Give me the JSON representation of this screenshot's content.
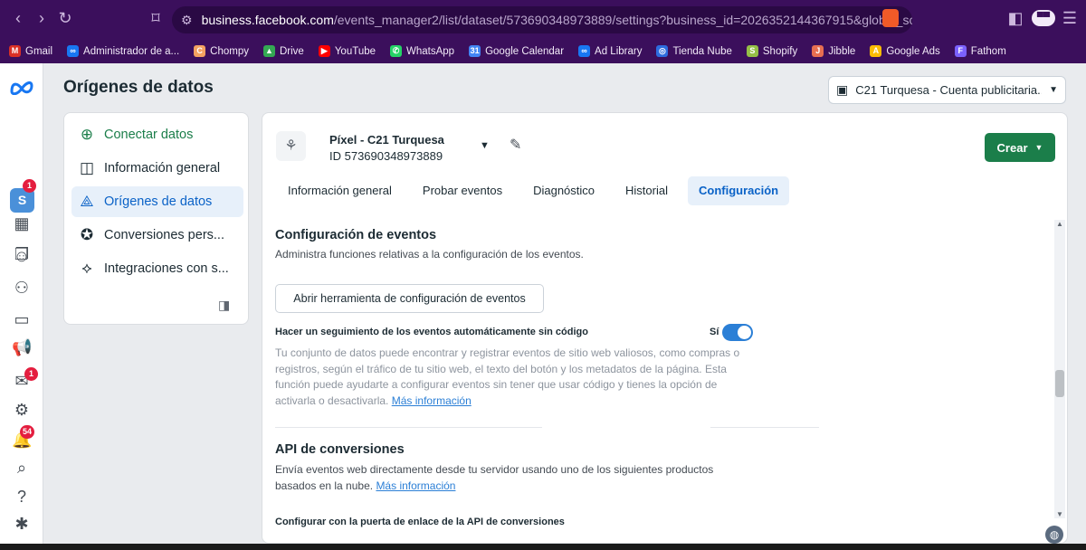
{
  "browser": {
    "url_host": "business.facebook.com",
    "url_rest": "/events_manager2/list/dataset/573690348973889/settings?business_id=2026352144367915&global_scope_id...",
    "bookmarks": [
      {
        "label": "Gmail",
        "icon": "gmail-icon",
        "color": "#d93025",
        "glyph": "M"
      },
      {
        "label": "Administrador de a...",
        "icon": "meta-icon",
        "color": "#1877f2",
        "glyph": "∞"
      },
      {
        "label": "Chompy",
        "icon": "chompy-icon",
        "color": "#f4a261",
        "glyph": "C"
      },
      {
        "label": "Drive",
        "icon": "drive-icon",
        "color": "#34a853",
        "glyph": "▲"
      },
      {
        "label": "YouTube",
        "icon": "youtube-icon",
        "color": "#ff0000",
        "glyph": "▶"
      },
      {
        "label": "WhatsApp",
        "icon": "whatsapp-icon",
        "color": "#25d366",
        "glyph": "✆"
      },
      {
        "label": "Google Calendar",
        "icon": "calendar-icon",
        "color": "#4285f4",
        "glyph": "31"
      },
      {
        "label": "Ad Library",
        "icon": "meta-icon",
        "color": "#1877f2",
        "glyph": "∞"
      },
      {
        "label": "Tienda Nube",
        "icon": "tiendanube-icon",
        "color": "#2d6cdf",
        "glyph": "◎"
      },
      {
        "label": "Shopify",
        "icon": "shopify-icon",
        "color": "#95bf47",
        "glyph": "S"
      },
      {
        "label": "Jibble",
        "icon": "jibble-icon",
        "color": "#e76f51",
        "glyph": "J"
      },
      {
        "label": "Google Ads",
        "icon": "googleads-icon",
        "color": "#fbbc04",
        "glyph": "A"
      },
      {
        "label": "Fathom",
        "icon": "fathom-icon",
        "color": "#7b61ff",
        "glyph": "F"
      }
    ]
  },
  "rail": {
    "avatar": "S",
    "badges": {
      "notifications": "1",
      "inbox": "1",
      "alerts": "54"
    }
  },
  "header": {
    "title": "Orígenes de datos",
    "account": "C21 Turquesa - Cuenta publicitaria..."
  },
  "sidebar": {
    "items": [
      {
        "label": "Conectar datos"
      },
      {
        "label": "Información general"
      },
      {
        "label": "Orígenes de datos"
      },
      {
        "label": "Conversiones pers..."
      },
      {
        "label": "Integraciones con s..."
      }
    ]
  },
  "pixel": {
    "name": "Píxel - C21 Turquesa",
    "id": "ID 573690348973889",
    "create_label": "Crear"
  },
  "tabs": [
    "Información general",
    "Probar eventos",
    "Diagnóstico",
    "Historial",
    "Configuración"
  ],
  "config": {
    "title": "Configuración de eventos",
    "desc": "Administra funciones relativas a la configuración de los eventos.",
    "open_tool": "Abrir herramienta de configuración de eventos",
    "auto_track_label": "Hacer un seguimiento de los eventos automáticamente sin código",
    "toggle_state": "Sí",
    "auto_track_desc": "Tu conjunto de datos puede encontrar y registrar eventos de sitio web valiosos, como compras o registros, según el tráfico de tu sitio web, el texto del botón y los metadatos de la página. Esta función puede ayudarte a configurar eventos sin tener que usar código y tienes la opción de activarla o desactivarla.",
    "more_info": "Más información"
  },
  "api": {
    "title": "API de conversiones",
    "desc": "Envía eventos web directamente desde tu servidor usando uno de los siguientes productos basados en la nube.",
    "more_info": "Más información",
    "gateway": "Configurar con la puerta de enlace de la API de conversiones"
  }
}
